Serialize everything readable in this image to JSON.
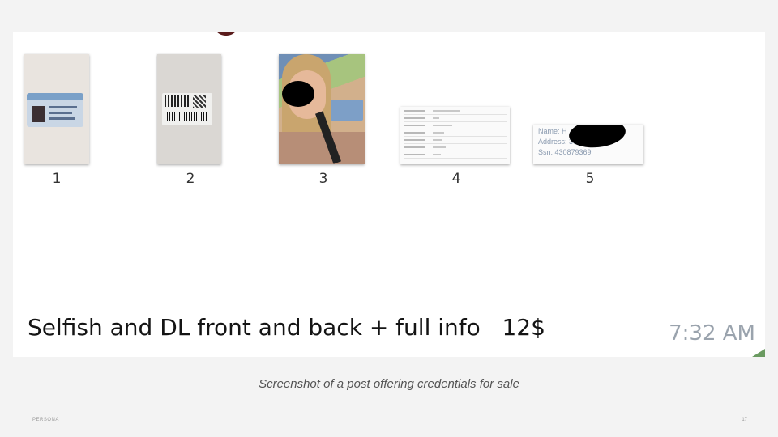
{
  "screenshot": {
    "thumbnails": [
      {
        "number": "1",
        "content": "id-front-image"
      },
      {
        "number": "2",
        "content": "id-back-image"
      },
      {
        "number": "3",
        "content": "selfie-with-id-image"
      },
      {
        "number": "4",
        "content": "info-form-image"
      },
      {
        "number": "5",
        "content": "info-card-image"
      }
    ],
    "info_card": {
      "name_line": "Name: H",
      "address_line": "Address: 30",
      "ssn_line": "Ssn: 430879369"
    },
    "message": "Selfish and DL front and back + full info   12$",
    "time": "7:32 AM"
  },
  "slide": {
    "caption": "Screenshot of a post offering credentials for sale",
    "footer_left": "PERSONA",
    "page_number": "17"
  },
  "colors": {
    "slide_bg": "#f3f3f3",
    "message_bg": "#ffffff",
    "time_text": "#9aa3ad",
    "bubble_tail": "#6a9a60"
  }
}
